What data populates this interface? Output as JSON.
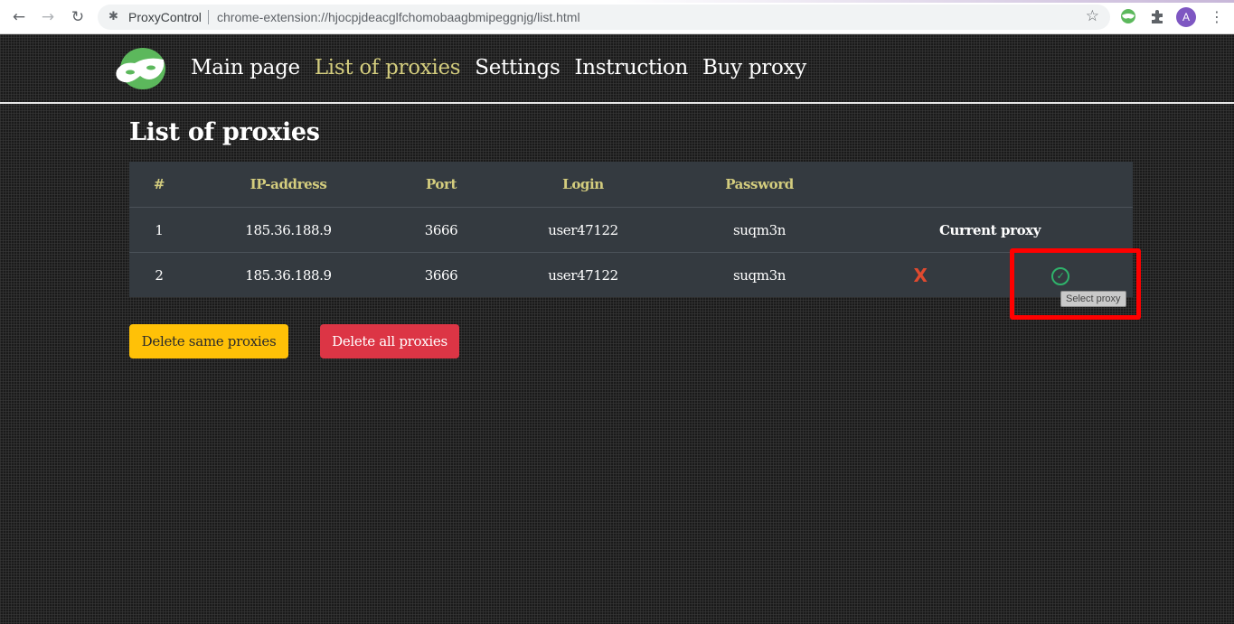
{
  "browser": {
    "back_icon": "arrow-left-icon",
    "forward_icon": "arrow-right-icon",
    "reload_icon": "reload-icon",
    "site_name": "ProxyControl",
    "url": "chrome-extension://hjocpjdeacglfchomobaagbmipeggnjg/list.html",
    "bookmark_icon": "star-icon",
    "profile_initial": "A",
    "profile_color": "#7e57c2"
  },
  "nav": {
    "items": [
      {
        "label": "Main page",
        "active": false
      },
      {
        "label": "List of proxies",
        "active": true
      },
      {
        "label": "Settings",
        "active": false
      },
      {
        "label": "Instruction",
        "active": false
      },
      {
        "label": "Buy proxy",
        "active": false
      }
    ],
    "active_color": "#d4cd7e"
  },
  "page": {
    "title": "List of proxies"
  },
  "table": {
    "headers": [
      "#",
      "IP-address",
      "Port",
      "Login",
      "Password"
    ],
    "rows": [
      {
        "num": "1",
        "ip": "185.36.188.9",
        "port": "3666",
        "login": "user47122",
        "password": "suqm3n",
        "status": "Current proxy"
      },
      {
        "num": "2",
        "ip": "185.36.188.9",
        "port": "3666",
        "login": "user47122",
        "password": "suqm3n",
        "delete_symbol": "X",
        "select_symbol": "✓"
      }
    ]
  },
  "tooltip": "Select proxy",
  "buttons": {
    "delete_same": "Delete same proxies",
    "delete_all": "Delete all proxies"
  },
  "colors": {
    "warning": "#ffc107",
    "danger": "#dc3545",
    "success": "#2fb36b",
    "table_bg": "#343a40"
  }
}
